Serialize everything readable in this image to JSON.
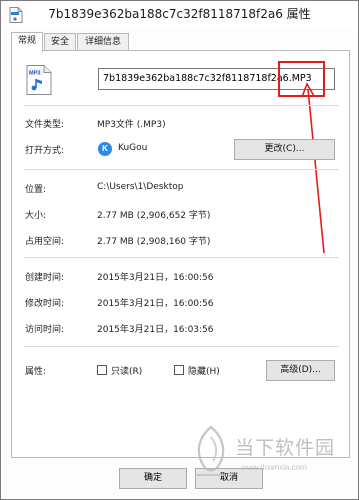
{
  "window": {
    "title": "7b1839e362ba188c7c32f8118718f2a6 属性"
  },
  "tabs": [
    {
      "label": "常规"
    },
    {
      "label": "安全"
    },
    {
      "label": "详细信息"
    }
  ],
  "file": {
    "icon": "mp3-file-icon",
    "icon_label": "MP3",
    "name": "7b1839e362ba188c7c32f8118718f2a6.MP3"
  },
  "fields": {
    "file_type_label": "文件类型:",
    "file_type_value": "MP3文件 (.MP3)",
    "opens_with_label": "打开方式:",
    "opens_with_value": "KuGou",
    "opens_with_icon_letter": "K",
    "change_button": "更改(C)...",
    "location_label": "位置:",
    "location_value": "C:\\Users\\1\\Desktop",
    "size_label": "大小:",
    "size_value": "2.77 MB (2,906,652 字节)",
    "size_on_disk_label": "占用空间:",
    "size_on_disk_value": "2.77 MB (2,908,160 字节)",
    "created_label": "创建时间:",
    "created_value": "2015年3月21日，16:00:56",
    "modified_label": "修改时间:",
    "modified_value": "2015年3月21日，16:00:56",
    "accessed_label": "访问时间:",
    "accessed_value": "2015年3月21日，16:03:56",
    "attributes_label": "属性:",
    "readonly_label": "只读(R)",
    "hidden_label": "隐藏(H)",
    "advanced_button": "高级(D)..."
  },
  "footer": {
    "ok_button": "确定",
    "cancel_button": "取消"
  },
  "watermark": {
    "text": "当下软件园",
    "sub": "www.downxia.com"
  },
  "colors": {
    "annotation": "#e21d1d",
    "kugou_blue": "#2a8ae6"
  }
}
